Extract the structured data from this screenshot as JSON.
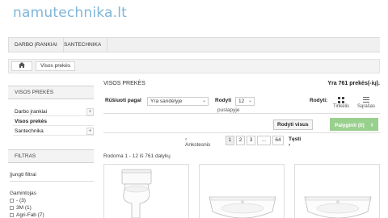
{
  "site": {
    "logo_text": "namutechnika.lt",
    "accent": "#7fb6d9"
  },
  "nav": {
    "items": [
      "DARBO ĮRANKIAI",
      "SANTECHNIKA"
    ]
  },
  "breadcrumb": {
    "home_icon": "home-icon",
    "current": "Visos prekės"
  },
  "sidebar": {
    "categories_title": "VISOS PREKĖS",
    "categories": [
      {
        "label": "Darbo įrankiai",
        "expandable": true
      },
      {
        "label": "Visos prekės",
        "expandable": false
      },
      {
        "label": "Santechnika",
        "expandable": true
      }
    ],
    "filters_title": "FILTRAS",
    "active_filters": "Įjungti filtrai",
    "manufacturer_label": "Gamintojas",
    "manufacturers": [
      "- (3)",
      "3M (1)",
      "Agri-Fab (7)"
    ]
  },
  "main": {
    "title": "VISOS PREKĖS",
    "total": "Yra 761 prekės(-ių).",
    "sort_label": "Rūšiuoti pagal",
    "sort_value": "Yra sandėlyje",
    "show_label": "Rodyti",
    "per_page_value": "12",
    "per_page_suffix": "puslapyje",
    "view_label": "Rodyti:",
    "view_grid": "Tinkelis",
    "view_list": "Sąrašas",
    "show_all": "Rodyti visus",
    "compare": "Palyginti (0)",
    "compare_arrow": "›",
    "prev": "Ankstesnis",
    "prev_arrow": "‹",
    "pages": [
      "1",
      "2",
      "3",
      "...",
      "64"
    ],
    "next": "Tęsti",
    "next_arrow": "›",
    "showing": "Rodoma 1 - 12 iš 761 dalykų",
    "products": [
      "toilet",
      "sink",
      "sink"
    ]
  },
  "colors": {
    "compare_green": "#9ad08d",
    "panel_gray": "#f3f3f3"
  }
}
